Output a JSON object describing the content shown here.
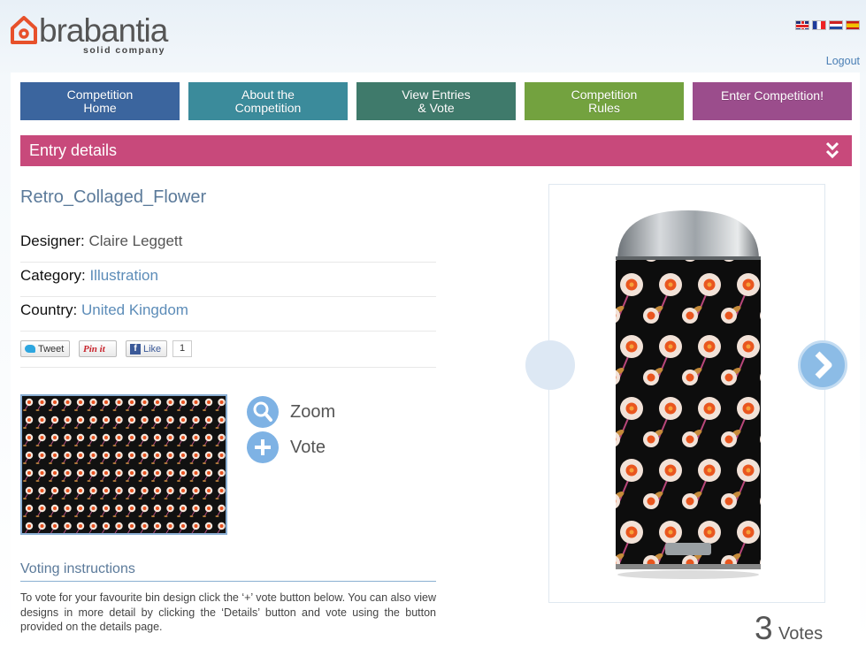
{
  "brand": {
    "name": "brabantia",
    "tagline": "solid company"
  },
  "languages": [
    "English",
    "Français",
    "Nederlands",
    "Español"
  ],
  "header": {
    "logout_label": "Logout"
  },
  "nav": [
    {
      "line1": "Competition",
      "line2": "Home"
    },
    {
      "line1": "About the",
      "line2": "Competition"
    },
    {
      "line1": "View Entries",
      "line2": "& Vote"
    },
    {
      "line1": "Competition",
      "line2": "Rules"
    },
    {
      "line1": "Enter Competition!",
      "line2": ""
    }
  ],
  "section": {
    "title": "Entry details"
  },
  "entry": {
    "name": "Retro_Collaged_Flower",
    "designer_label": "Designer:",
    "designer": "Claire Leggett",
    "category_label": "Category:",
    "category": "Illustration",
    "country_label": "Country:",
    "country": "United Kingdom"
  },
  "social": {
    "tweet_label": "Tweet",
    "pin_label": "Pin it",
    "like_label": "Like",
    "like_count": "1"
  },
  "actions": {
    "zoom_label": "Zoom",
    "vote_label": "Vote"
  },
  "voting": {
    "title": "Voting instructions",
    "text": "To vote for your favourite bin design click the ‘+’ vote button below. You can also view designs in more detail by clicking the ‘Details’ button and vote using the button provided on the details page."
  },
  "votes": {
    "count": "3",
    "label": "Votes"
  },
  "colors": {
    "nav_home": "#3b659e",
    "nav_about": "#3b8b9b",
    "nav_view": "#3f7a6b",
    "nav_rules": "#73a23f",
    "nav_enter": "#9b4d8c",
    "section_bar": "#c8497b",
    "accent_link": "#5c8cb8",
    "action_circle": "#7eb2e4"
  },
  "icons": [
    "brabantia-house-logo",
    "flag-uk-icon",
    "flag-fr-icon",
    "flag-nl-icon",
    "flag-es-icon",
    "double-chevron-down-icon",
    "twitter-bird-icon",
    "pinterest-icon",
    "facebook-icon",
    "zoom-magnifier-icon",
    "plus-icon",
    "chevron-left-icon",
    "chevron-right-icon"
  ]
}
